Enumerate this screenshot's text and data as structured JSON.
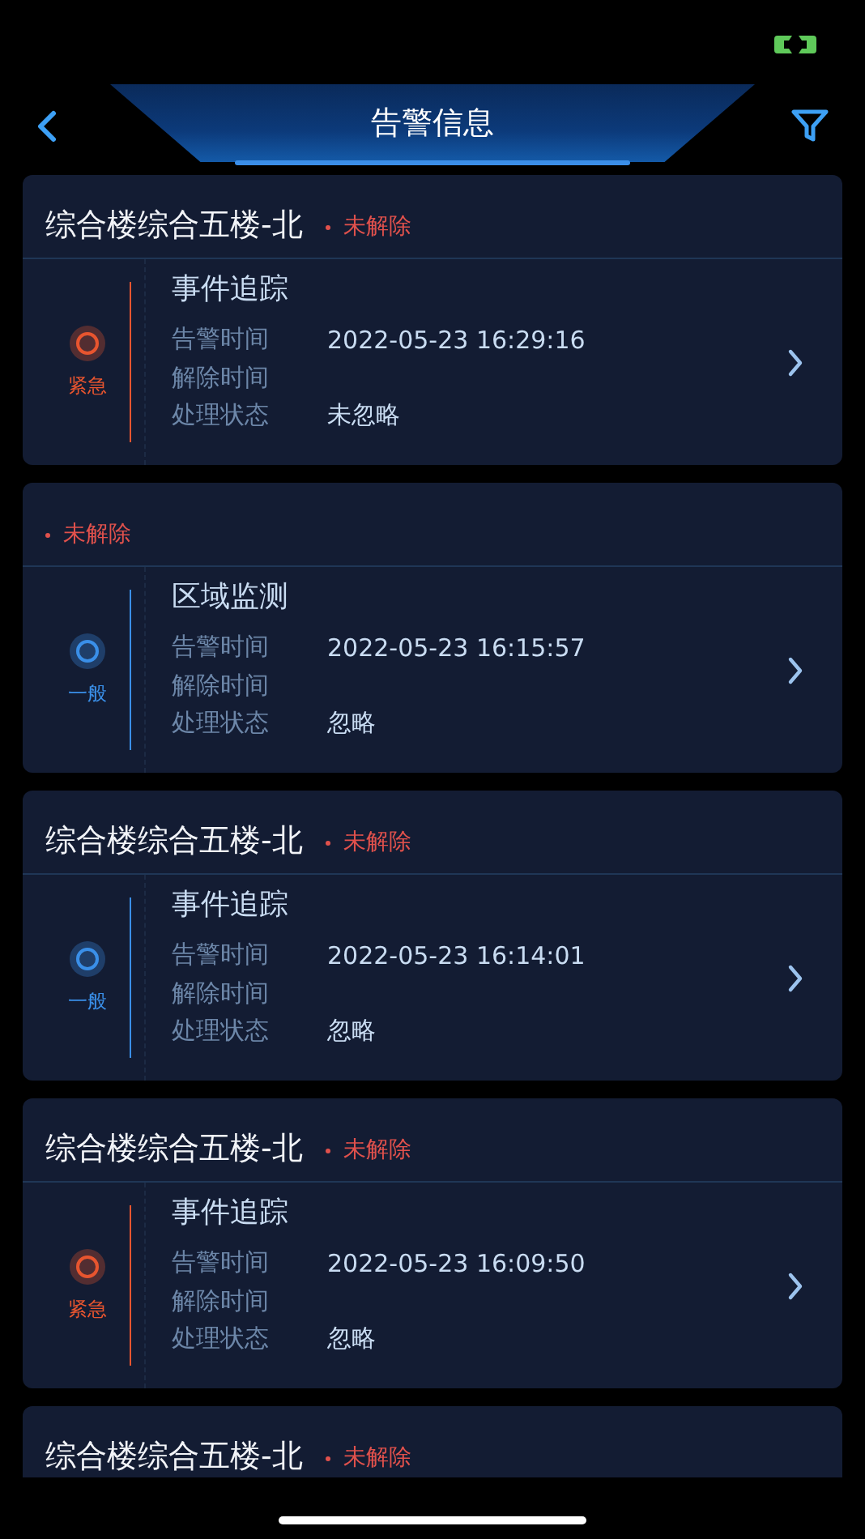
{
  "header": {
    "title": "告警信息"
  },
  "alarms": [
    {
      "location": "综合楼综合五楼-北",
      "status": "未解除",
      "event": "事件追踪",
      "kind": "urgent",
      "level_label": "紧急",
      "fields": [
        {
          "label": "告警时间",
          "value": "2022-05-23 16:29:16"
        },
        {
          "label": "解除时间"
        },
        {
          "label": "处理状态",
          "value": "未忽略"
        }
      ]
    },
    {
      "status": "未解除",
      "event": "区域监测",
      "kind": "normal",
      "level_label": "一般",
      "fields": [
        {
          "label": "告警时间",
          "value": "2022-05-23 16:15:57"
        },
        {
          "label": "解除时间"
        },
        {
          "label": "处理状态",
          "value": "忽略"
        }
      ]
    },
    {
      "location": "综合楼综合五楼-北",
      "status": "未解除",
      "event": "事件追踪",
      "kind": "normal",
      "level_label": "一般",
      "fields": [
        {
          "label": "告警时间",
          "value": "2022-05-23 16:14:01"
        },
        {
          "label": "解除时间"
        },
        {
          "label": "处理状态",
          "value": "忽略"
        }
      ]
    },
    {
      "location": "综合楼综合五楼-北",
      "status": "未解除",
      "event": "事件追踪",
      "kind": "urgent",
      "level_label": "紧急",
      "fields": [
        {
          "label": "告警时间",
          "value": "2022-05-23 16:09:50"
        },
        {
          "label": "解除时间"
        },
        {
          "label": "处理状态",
          "value": "忽略"
        }
      ]
    },
    {
      "location": "综合楼综合五楼-北",
      "status": "未解除"
    }
  ]
}
